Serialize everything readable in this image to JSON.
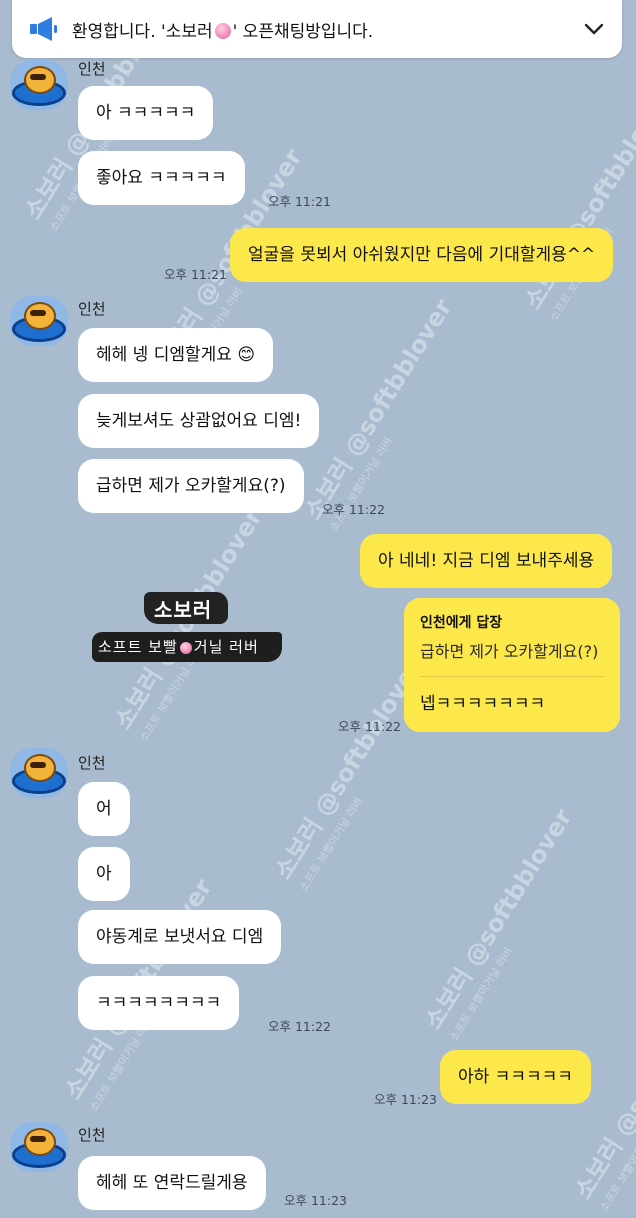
{
  "notice": {
    "text_before": "환영합니다. '소보러",
    "text_after": "' 오픈채팅방입니다.",
    "icon": "megaphone-icon",
    "chevron": "chevron-down-icon"
  },
  "sender_name": "인천",
  "watermark": {
    "line1": "소보러",
    "line2": "@softbblover",
    "line3": "소프트 보빨이거닐 러버"
  },
  "messages": {
    "m1": "아 ㅋㅋㅋㅋㅋ",
    "m2": "좋아요 ㅋㅋㅋㅋㅋ",
    "t1": "오후 11:21",
    "o1": "얼굴을 못뵈서 아쉬웠지만 다음에 기대할게용^^",
    "t2": "오후 11:21",
    "m3": "헤헤 넹 디엠할게요 😊",
    "m4": "늦게보셔도 상괌없어요 디엠!",
    "m5": "급하면 제가 오카할게요(?)",
    "t3": "오후 11:22",
    "o2": "아 네네! 지금 디엠 보내주세용",
    "reply_title": "인천에게 답장",
    "reply_quote": "급하면 제가 오카할게요(?)",
    "reply_answer": "넵ㅋㅋㅋㅋㅋㅋㅋ",
    "t4": "오후 11:22",
    "m6": "어",
    "m7": "아",
    "m8": "야동계로 보냇서요 디엠",
    "m9": "ㅋㅋㅋㅋㅋㅋㅋㅋ",
    "t5": "오후 11:22",
    "o3": "아하 ㅋㅋㅋㅋㅋ",
    "t6": "오후 11:23",
    "m10": "헤헤 또 연락드릴게용",
    "t7": "오후 11:23"
  },
  "sticker": {
    "line1": "소보러",
    "line2a": "소프트 보빨",
    "line2b": "거닐 러버"
  }
}
